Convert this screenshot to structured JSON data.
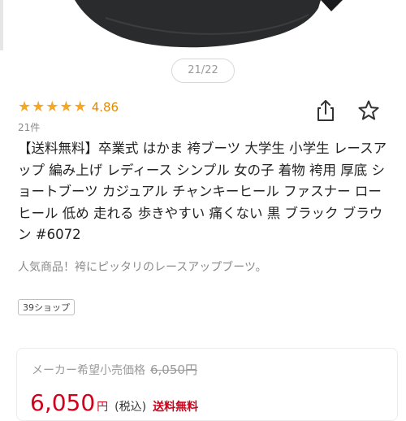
{
  "gallery": {
    "image_alt": "product-photo-boot",
    "counter": "21/22"
  },
  "rating": {
    "stars": 5,
    "value": "4.86",
    "review_count": "21件",
    "star_color": "#f5a623"
  },
  "actions": {
    "share_icon": "share-icon",
    "favorite_icon": "star-outline-icon"
  },
  "product": {
    "title": "【送料無料】卒業式 はかま 袴ブーツ 大学生 小学生 レースアップ 編み上げ レディース シンプル 女の子 着物 袴用 厚底 ショートブーツ カジュアル チャンキーヒール ファスナー ローヒール 低め 走れる 歩きやすい 痛くない 黒 ブラック ブラウン #6072",
    "subtitle": "人気商品！袴にピッタリのレースアップブーツ。",
    "shop_badge": "39ショップ"
  },
  "pricing": {
    "msrp_label": "メーカー希望小売価格",
    "msrp_value": "6,050円",
    "price": "6,050",
    "currency": "円",
    "tax_note": "(税込)",
    "shipping": "送料無料",
    "accent_color": "#d0021b"
  }
}
